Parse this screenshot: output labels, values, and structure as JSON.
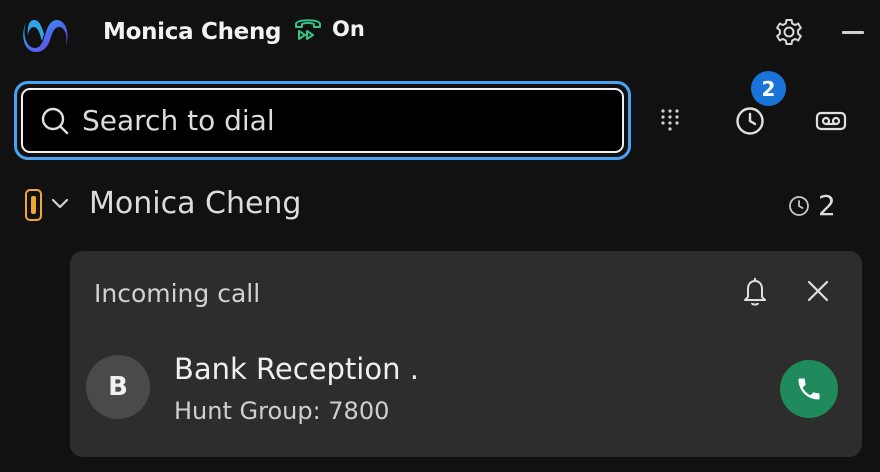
{
  "titlebar": {
    "user_name": "Monica Cheng",
    "status_label": "On",
    "settings_icon": "gear-icon",
    "minimize_icon": "minimize-icon"
  },
  "search": {
    "placeholder": "Search to dial"
  },
  "toolbar": {
    "dialpad_icon": "dialpad-icon",
    "history_icon": "clock-icon",
    "history_badge": "2",
    "voicemail_icon": "voicemail-icon"
  },
  "line": {
    "name": "Monica Cheng",
    "count": "2"
  },
  "incoming": {
    "title": "Incoming call",
    "avatar_initial": "B",
    "caller_name": "Bank Reception .",
    "caller_detail": "Hunt Group: 7800"
  },
  "colors": {
    "background": "#111111",
    "accent_blue": "#4aa3f0",
    "badge_blue": "#1a73d9",
    "status_green": "#36c08a",
    "answer_green": "#1f8a5b",
    "line_orange": "#f2a735",
    "card_bg": "#2d2d2d"
  }
}
